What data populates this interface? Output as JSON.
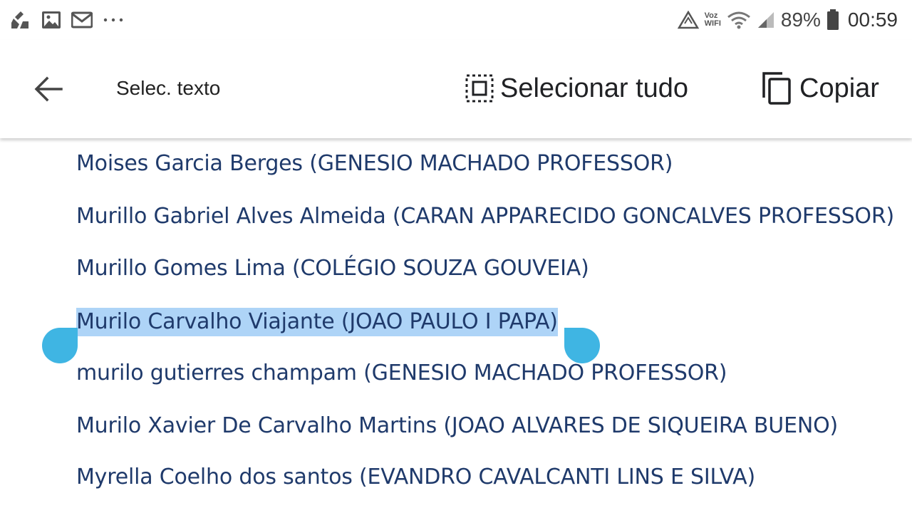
{
  "status_bar": {
    "left_icons": [
      "cleaner-icon",
      "image-icon",
      "gmail-icon",
      "more-dots-icon"
    ],
    "voz_label": "Voz",
    "wifi_label": "WIFI",
    "battery_percent": "89%",
    "time": "00:59"
  },
  "toolbar": {
    "back_icon": "arrow-left-icon",
    "title": "Selec. texto",
    "select_all_label": "Selecionar tudo",
    "copy_label": "Copiar"
  },
  "document": {
    "entries": [
      {
        "text": "Moises Garcia Berges (GENESIO MACHADO PROFESSOR)",
        "selected": false
      },
      {
        "text": "Murillo Gabriel Alves Almeida (CARAN APPARECIDO GONCALVES PROFESSOR)",
        "selected": false
      },
      {
        "text": "Murillo Gomes Lima (COLÉGIO SOUZA GOUVEIA)",
        "selected": false
      },
      {
        "text": "Murilo Carvalho Viajante (JOAO PAULO I PAPA)",
        "selected": true
      },
      {
        "text": "murilo gutierres champam (GENESIO MACHADO PROFESSOR)",
        "selected": false
      },
      {
        "text": "Murilo Xavier De Carvalho Martins (JOAO ALVARES DE SIQUEIRA BUENO)",
        "selected": false
      },
      {
        "text": "Myrella Coelho dos santos (EVANDRO CAVALCANTI LINS E SILVA)",
        "selected": false
      }
    ]
  },
  "colors": {
    "text": "#1f3a6b",
    "selection_highlight": "#aed4f7",
    "selection_handle": "#3fb5e3"
  }
}
